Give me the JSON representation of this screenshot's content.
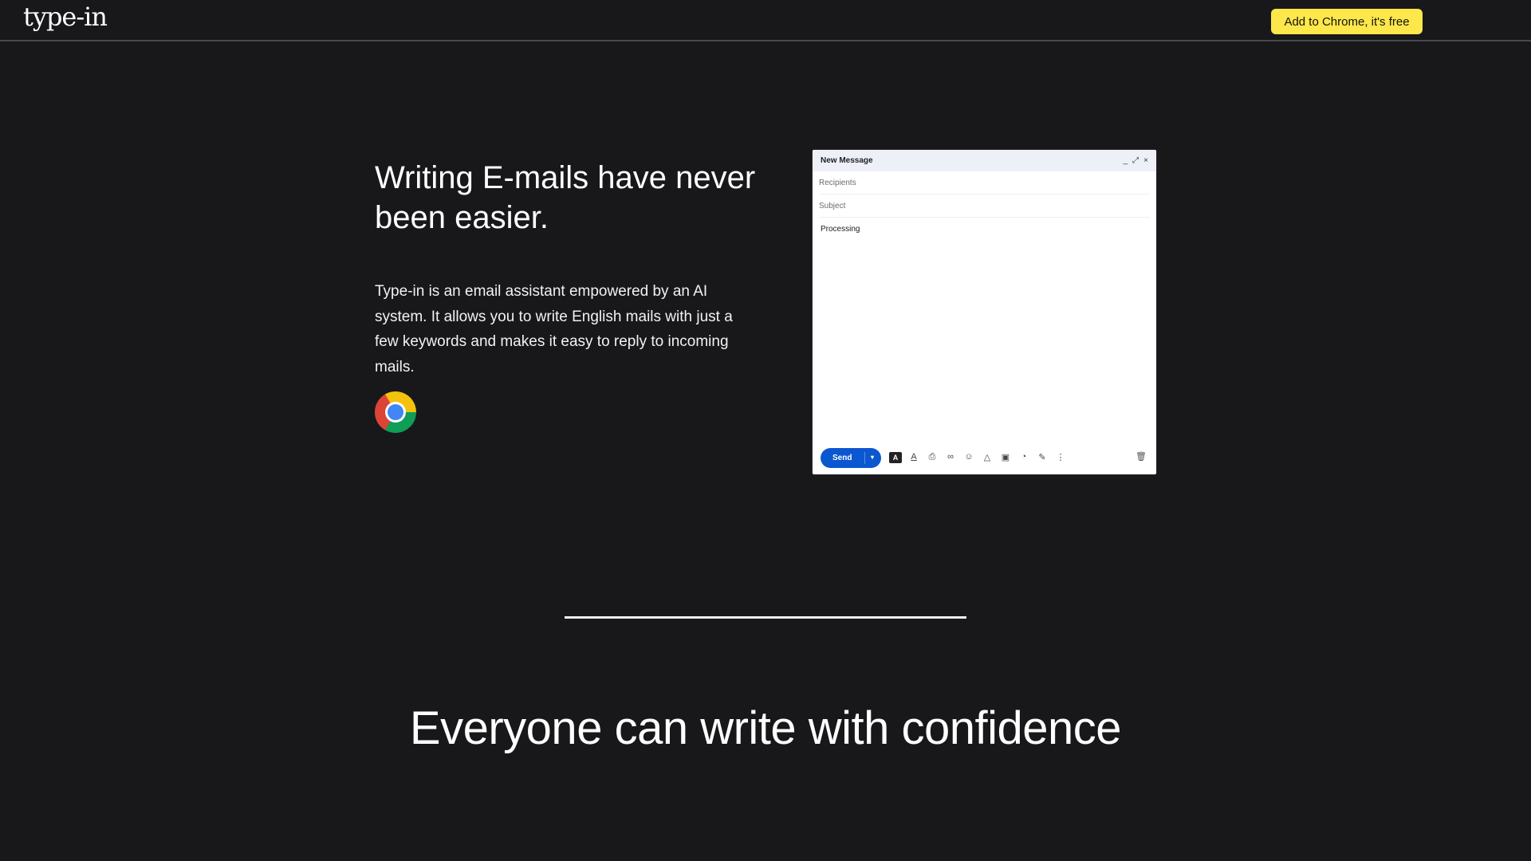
{
  "nav": {
    "logo": "type-in",
    "cta_label": "Add to Chrome, it's free"
  },
  "hero": {
    "title": "Writing E-mails have never been easier.",
    "description": "Type-in is an email assistant empowered by an AI system. It allows you to write English mails with just a few keywords and makes it easy to reply to incoming mails.",
    "browser_icon": "chrome-icon"
  },
  "compose": {
    "title": "New Message",
    "controls": [
      "_",
      "⤢",
      "×"
    ],
    "recipients_placeholder": "Recipients",
    "subject_placeholder": "Subject",
    "body": "Processing",
    "send_label": "Send",
    "toolbar_icons": [
      "format-icon",
      "text-color-icon",
      "attach-icon",
      "link-icon",
      "emoji-icon",
      "drive-icon",
      "image-icon",
      "lock-icon",
      "signature-icon",
      "more-icon"
    ],
    "trash_icon": "trash-icon"
  },
  "section2": {
    "tagline": "Everyone can write with confidence"
  },
  "colors": {
    "background": "#18181a",
    "cta": "#fde74a",
    "send": "#0b57d0"
  }
}
